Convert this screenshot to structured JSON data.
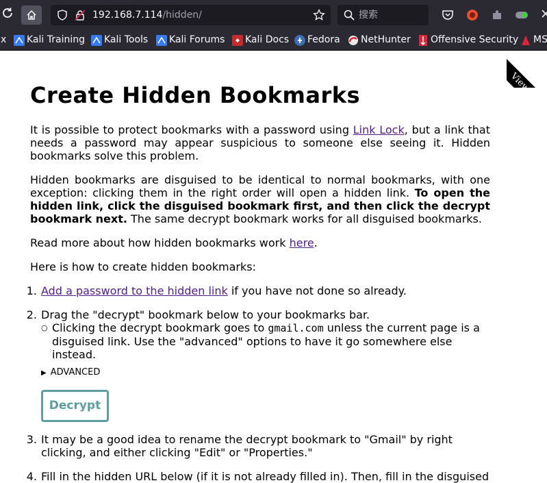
{
  "browser": {
    "url_host": "192.168.7.114",
    "url_path": "/hidden/",
    "search_placeholder": "搜索"
  },
  "bookmarks_bar": {
    "items": [
      {
        "label": "x"
      },
      {
        "label": "Kali Training"
      },
      {
        "label": "Kali Tools"
      },
      {
        "label": "Kali Forums"
      },
      {
        "label": "Kali Docs"
      },
      {
        "label": "Fedora"
      },
      {
        "label": "NetHunter"
      },
      {
        "label": "Offensive Security"
      },
      {
        "label": "MS"
      }
    ]
  },
  "ribbon": {
    "label": "View o"
  },
  "page": {
    "title": "Create Hidden Bookmarks",
    "p1_before": "It is possible to protect bookmarks with a password using ",
    "p1_link": "Link Lock",
    "p1_after": ", but a link that needs a password may appear suspicious to someone else seeing it. Hidden bookmarks solve this problem.",
    "p2_before": "Hidden bookmarks are disguised to be identical to normal bookmarks, with one exception: clicking them in the right order will open a hidden link. ",
    "p2_bold": "To open the hidden link, click the disguised bookmark first, and then click the decrypt bookmark next.",
    "p2_after": " The same decrypt bookmark works for all disguised bookmarks.",
    "p3_before": "Read more about how hidden bookmarks work ",
    "p3_link": "here",
    "p3_after": ".",
    "p4": "Here is how to create hidden bookmarks:",
    "steps": [
      {
        "num": "1.",
        "link": "Add a password to the hidden link",
        "text": " if you have not done so already."
      },
      {
        "num": "2.",
        "text": "Drag the \"decrypt\" bookmark below to your bookmarks bar."
      },
      {
        "num": "3.",
        "text": "It may be a good idea to rename the decrypt bookmark to \"Gmail\" by right clicking, and either clicking \"Edit\" or \"Properties.\""
      },
      {
        "num": "4.",
        "text": "Fill in the hidden URL below (if it is not already filled in). Then, fill in the disguised"
      }
    ],
    "sub_before": "Clicking the decrypt bookmark goes to ",
    "sub_code": "gmail.com",
    "sub_after": " unless the current page is a disguised link. Use the \"advanced\" options to have it go somewhere else instead.",
    "advanced_label": "ADVANCED",
    "decrypt_label": "Decrypt"
  }
}
